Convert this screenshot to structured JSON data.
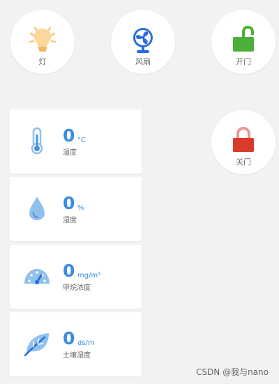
{
  "controls": {
    "light_label": "灯",
    "fan_label": "风扇",
    "open_label": "开门",
    "close_label": "关门"
  },
  "sensors": {
    "temperature": {
      "value": "0",
      "unit": "°C",
      "name": "温度"
    },
    "humidity": {
      "value": "0",
      "unit": "%",
      "name": "湿度"
    },
    "methane": {
      "value": "0",
      "unit": "mg/m³",
      "name": "甲烷浓度"
    },
    "soil": {
      "value": "0",
      "unit": "ds/m",
      "name": "土壤湿度"
    }
  },
  "watermark": "CSDN @我与nano",
  "colors": {
    "accent": "#3c8be3",
    "bulb": "#f7c77a",
    "fan": "#2b6de0",
    "unlock": "#4caf3a",
    "lock": "#d93a2b",
    "sensor_icon": "#8fc1ec"
  },
  "icons": {
    "light": "lightbulb-icon",
    "fan": "fan-icon",
    "open": "unlock-icon",
    "close": "lock-icon",
    "temperature": "thermometer-icon",
    "humidity": "droplet-icon",
    "methane": "gauge-icon",
    "soil": "leaf-icon"
  }
}
